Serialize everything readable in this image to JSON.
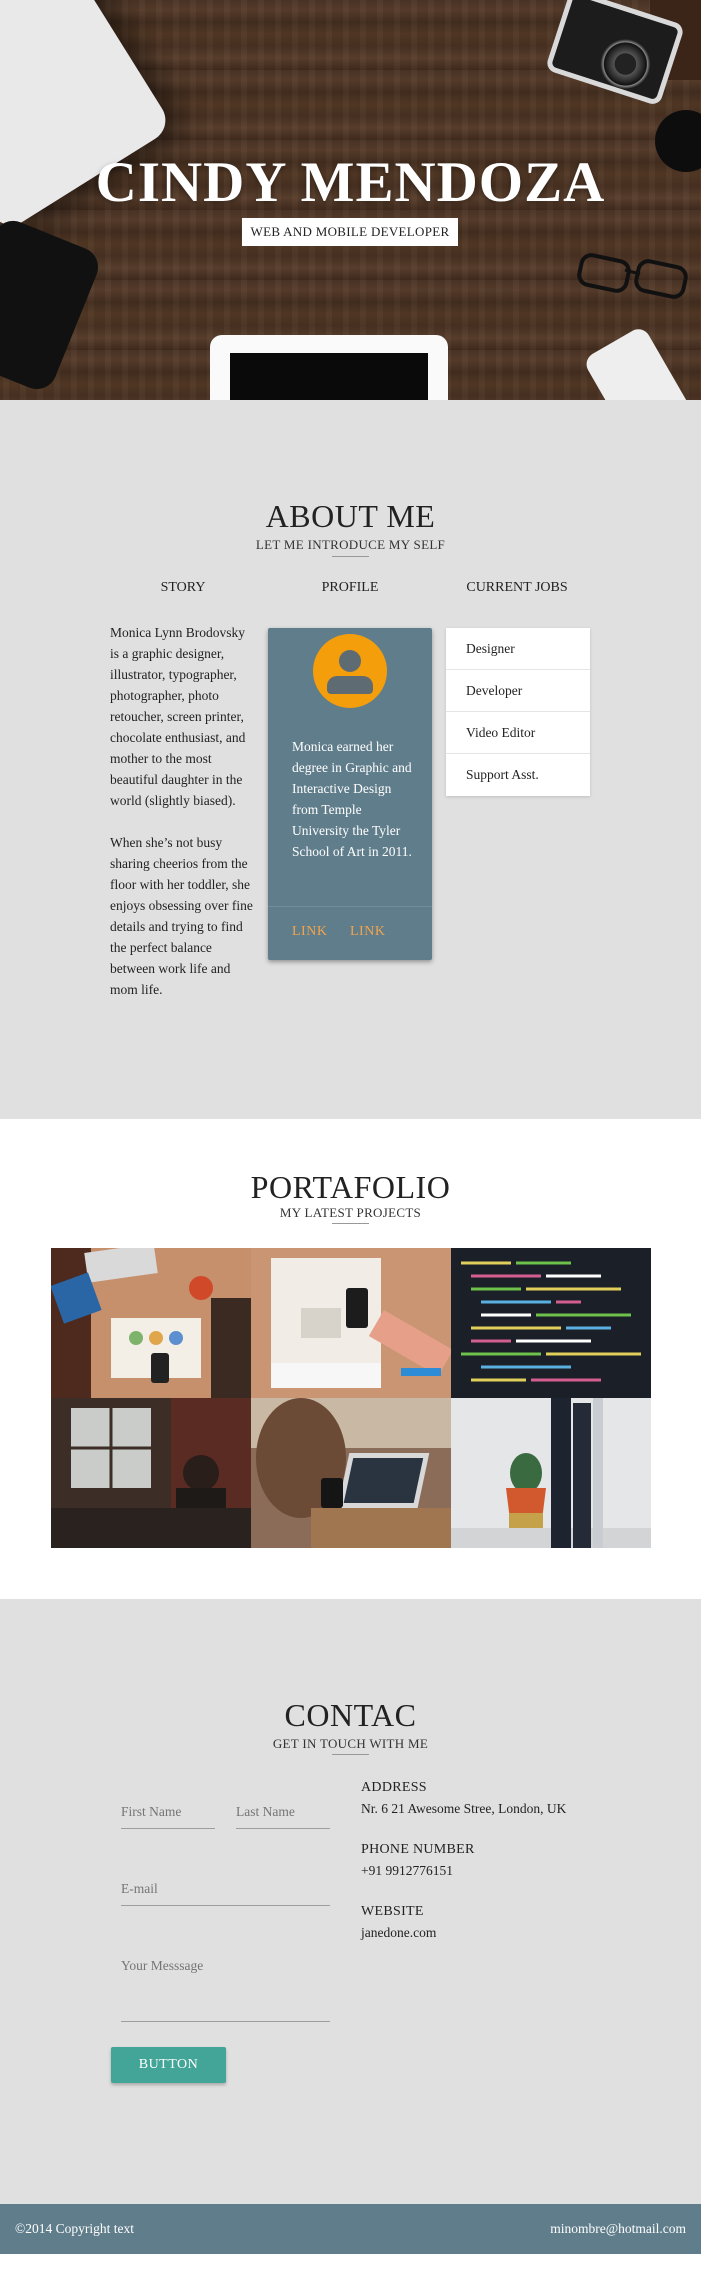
{
  "hero": {
    "title": "CINDY MENDOZA",
    "subtitle": "WEB AND MOBILE DEVELOPER"
  },
  "about": {
    "title": "ABOUT ME",
    "subtitle": "LET ME INTRODUCE MY SELF",
    "columns": {
      "story": "STORY",
      "profile": "PROFILE",
      "jobs": "CURRENT JOBS"
    },
    "story_paragraphs": [
      "Monica Lynn Brodovsky is a graphic designer, illustrator, typographer, photographer, photo retoucher, screen printer, chocolate enthusiast, and mother to the most beautiful daughter in the world (slightly biased).",
      "When she’s not busy sharing cheerios from the floor with her toddler, she enjoys obsessing over fine details and trying to find the perfect balance between work life and mom life."
    ],
    "profile": {
      "avatar_icon": "user-icon",
      "bio": "Monica earned her degree in Graphic and Interactive Design from Temple University the Tyler School of Art in 2011.",
      "links": [
        "LINK",
        "LINK"
      ]
    },
    "jobs": [
      "Designer",
      "Developer",
      "Video Editor",
      "Support Asst."
    ]
  },
  "portfolio": {
    "title": "PORTAFOLIO",
    "subtitle": "MY LATEST PROJECTS",
    "projects": [
      "desk-workspace-photo",
      "sketching-wireframes-photo",
      "code-screen-photo",
      "cafe-laptop-photo",
      "woman-laptop-photo",
      "plant-books-photo"
    ]
  },
  "contact": {
    "title": "CONTAC",
    "subtitle": "GET IN TOUCH WITH ME",
    "form": {
      "first_name_placeholder": "First Name",
      "last_name_placeholder": "Last Name",
      "email_placeholder": "E-mail",
      "message_placeholder": "Your Messsage",
      "button": "BUTTON"
    },
    "info": {
      "address_label": "ADDRESS",
      "address": "Nr. 6 21 Awesome Stree, London, UK",
      "phone_label": "PHONE NUMBER",
      "phone": "+91 9912776151",
      "website_label": "WEBSITE",
      "website": "janedone.com"
    }
  },
  "footer": {
    "copyright": "©2014 Copyright text",
    "email": "minombre@hotmail.com"
  },
  "colors": {
    "card_bg": "#607d8b",
    "avatar": "#f59e0b",
    "link_accent": "#f3a44b",
    "button": "#42a597",
    "section_gray": "#e0e0e0",
    "footer": "#607d8b"
  }
}
